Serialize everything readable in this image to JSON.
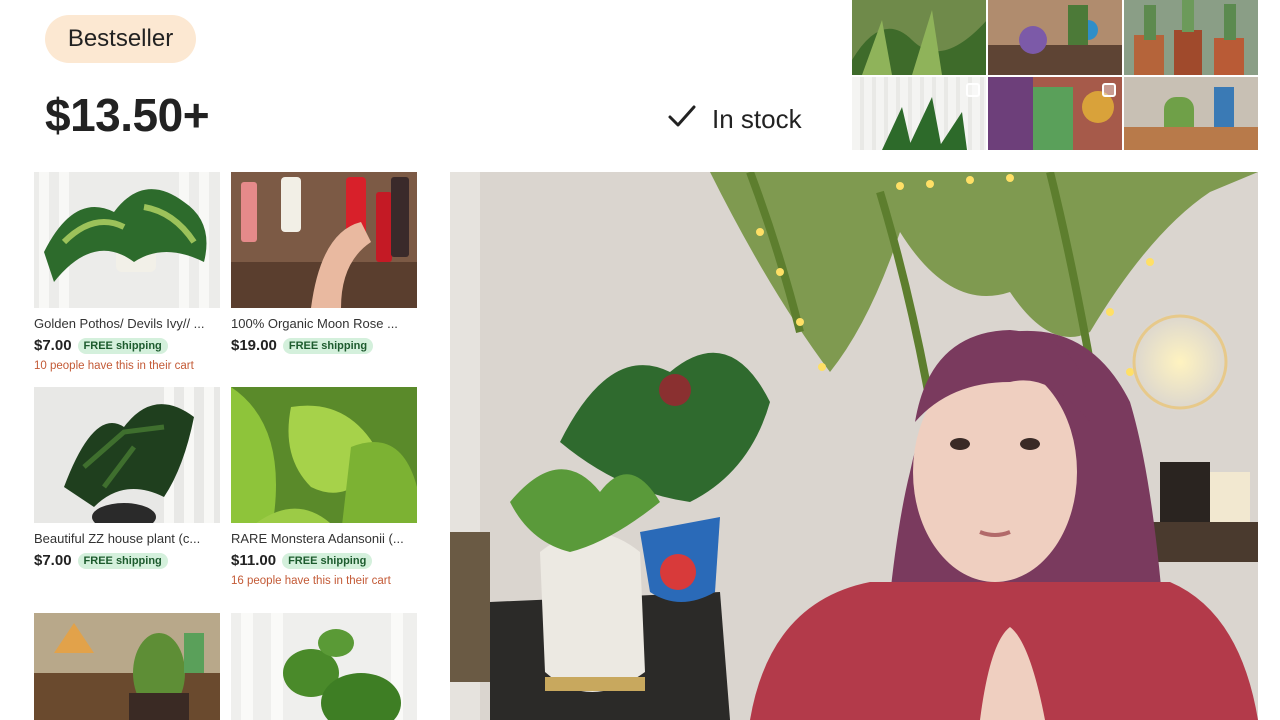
{
  "badge": "Bestseller",
  "price": "$13.50+",
  "stock": {
    "label": "In stock",
    "icon": "check-icon"
  },
  "colors": {
    "badge_bg": "#fce8d2",
    "ship_bg": "#d4f0dc",
    "ship_text": "#1d5b2e",
    "cart_text": "#c35a36"
  },
  "products": [
    {
      "title": "Golden Pothos/ Devils Ivy// ...",
      "price": "$7.00",
      "shipping": "FREE shipping",
      "cart": "10 people have this in their cart"
    },
    {
      "title": "100% Organic Moon Rose ...",
      "price": "$19.00",
      "shipping": "FREE shipping",
      "cart": ""
    },
    {
      "title": "Beautiful ZZ house plant (c...",
      "price": "$7.00",
      "shipping": "FREE shipping",
      "cart": ""
    },
    {
      "title": "RARE Monstera Adansonii (...",
      "price": "$11.00",
      "shipping": "FREE shipping",
      "cart": "16 people have this in their cart"
    },
    {
      "title": "",
      "price": "",
      "shipping": "",
      "cart": ""
    },
    {
      "title": "",
      "price": "",
      "shipping": "",
      "cart": ""
    }
  ]
}
